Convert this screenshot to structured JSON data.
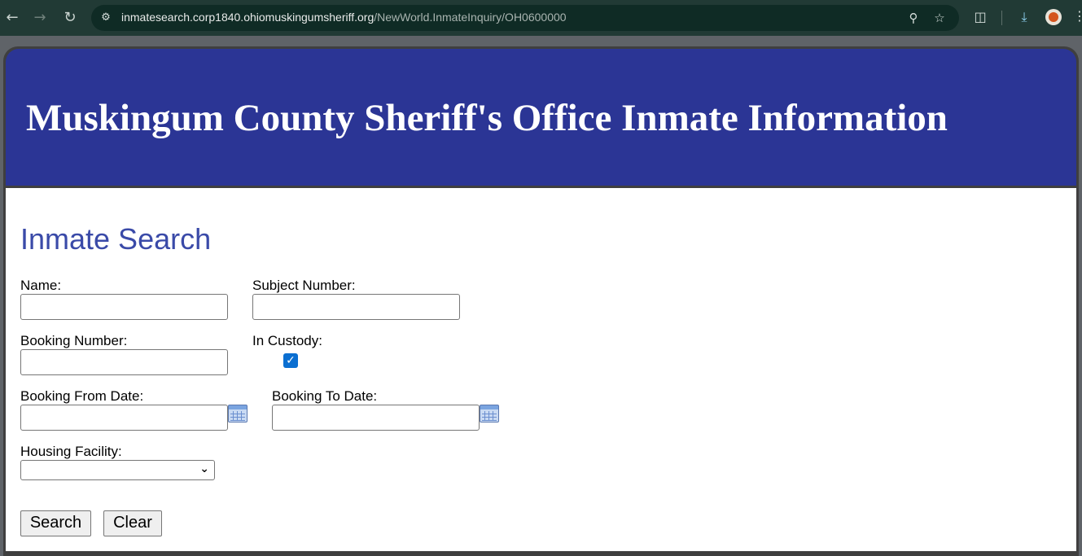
{
  "browser": {
    "url_host": "inmatesearch.corp1840.ohiomuskingumsheriff.org",
    "url_path": "/NewWorld.InmateInquiry/OH0600000",
    "icons": {
      "back": "arrow-left-icon",
      "forward": "arrow-right-icon",
      "reload": "reload-icon",
      "site_info": "site-info-icon",
      "zoom": "zoom-icon",
      "bookmark": "star-icon",
      "extensions": "puzzle-icon",
      "downloads": "download-icon",
      "profile": "avatar"
    }
  },
  "header": {
    "title": "Muskingum County Sheriff's Office Inmate Information",
    "background": "#2b3595"
  },
  "search": {
    "title": "Inmate Search",
    "title_color": "#3a4aa8",
    "name_label": "Name:",
    "name_value": "",
    "subject_number_label": "Subject Number:",
    "subject_number_value": "",
    "booking_number_label": "Booking Number:",
    "booking_number_value": "",
    "in_custody_label": "In Custody:",
    "in_custody_checked": true,
    "booking_from_label": "Booking From Date:",
    "booking_from_value": "",
    "booking_to_label": "Booking To Date:",
    "booking_to_value": "",
    "housing_facility_label": "Housing Facility:",
    "housing_facility_value": "",
    "search_button": "Search",
    "clear_button": "Clear"
  }
}
